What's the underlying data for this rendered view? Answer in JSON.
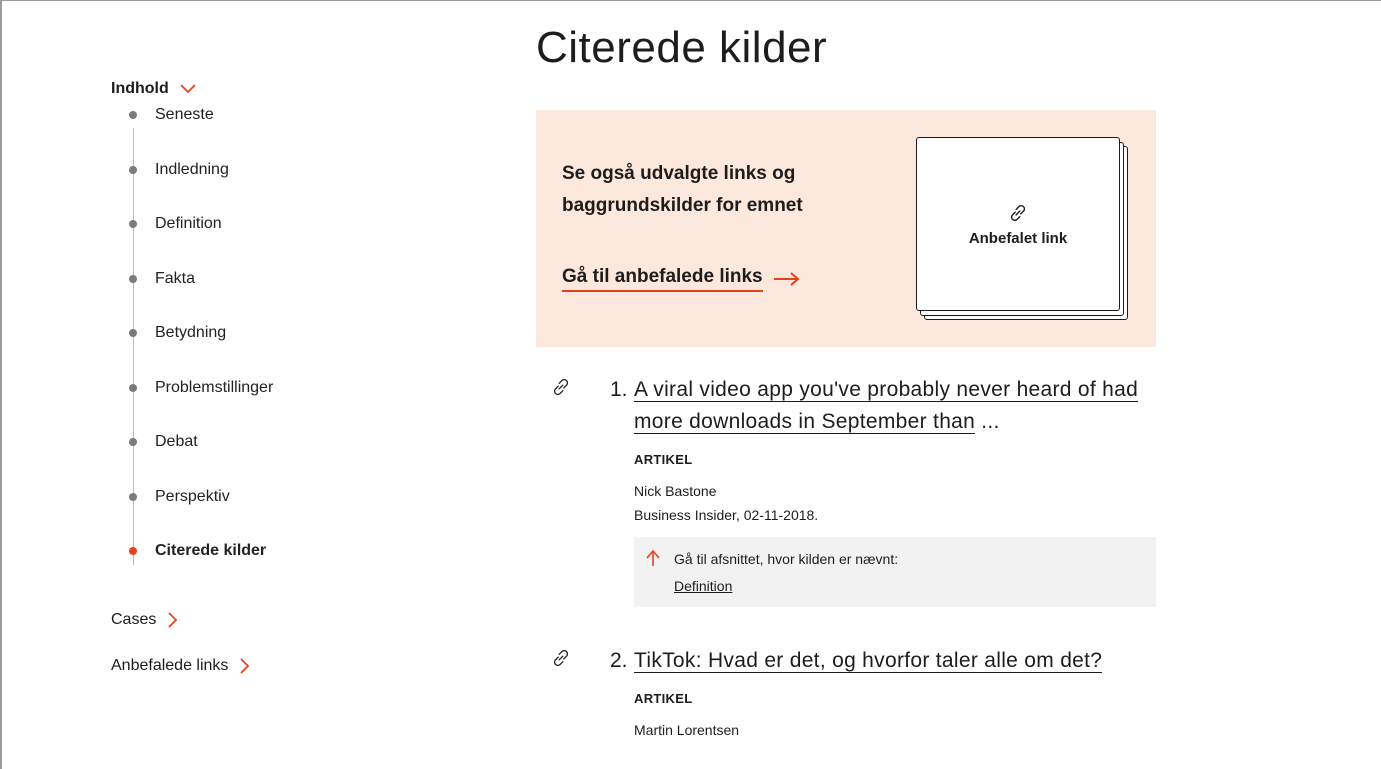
{
  "sidebar": {
    "heading": "Indhold",
    "toc": [
      {
        "label": "Seneste"
      },
      {
        "label": "Indledning"
      },
      {
        "label": "Definition"
      },
      {
        "label": "Fakta"
      },
      {
        "label": "Betydning"
      },
      {
        "label": "Problemstillinger"
      },
      {
        "label": "Debat"
      },
      {
        "label": "Perspektiv"
      },
      {
        "label": "Citerede kilder",
        "active": true
      }
    ],
    "cases_label": "Cases",
    "recommended_label": "Anbefalede links"
  },
  "main": {
    "title": "Citerede kilder",
    "promo": {
      "text": "Se også udvalgte links og baggrundskilder for emnet",
      "link_label": "Gå til anbefalede links",
      "card_label": "Anbefalet link"
    },
    "references": [
      {
        "number": "1.",
        "title_linked": "A viral video app you've probably never heard of had more downloads in September than",
        "title_tail": " ...",
        "kind": "ARTIKEL",
        "author": "Nick Bastone",
        "source": "Business Insider, 02-11-2018.",
        "back_text": "Gå til afsnittet, hvor kilden er nævnt:",
        "back_link": "Definition"
      },
      {
        "number": "2.",
        "title_linked": "TikTok: Hvad er det, og hvorfor taler alle om det?",
        "title_tail": "",
        "kind": "ARTIKEL",
        "author": "Martin Lorentsen"
      }
    ]
  },
  "colors": {
    "accent": "#e8401c",
    "promo_bg": "#fde8dd",
    "back_bg": "#f2f2f2"
  }
}
